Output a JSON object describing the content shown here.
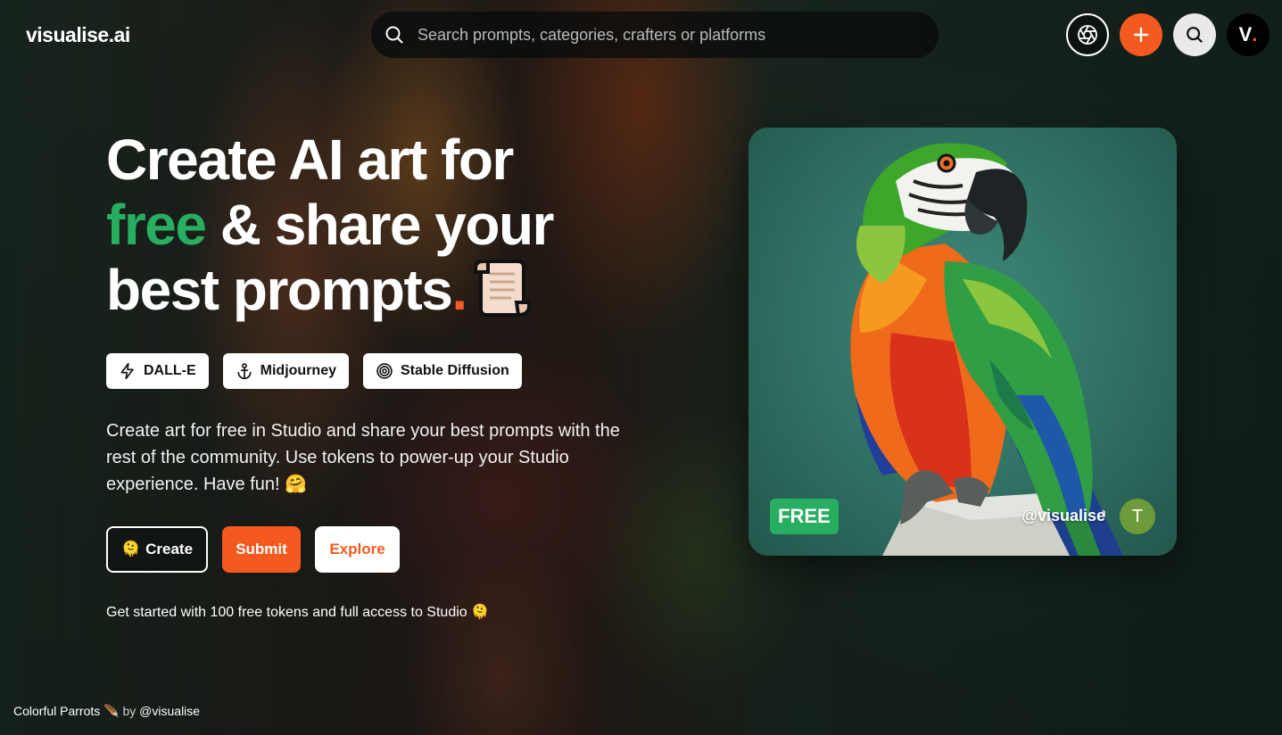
{
  "header": {
    "logo": "visualise",
    "logo_suffix": ".ai",
    "search_placeholder": "Search prompts, categories, crafters or platforms",
    "icons": [
      "aperture-icon",
      "plus-icon",
      "search-icon"
    ],
    "avatar_letter": "V",
    "avatar_dot": "."
  },
  "hero": {
    "line1": "Create AI art for",
    "line2_green": "free",
    "line2_rest": " & share your",
    "line3": "best prompts",
    "line3_dot": ".",
    "platforms": [
      {
        "label": "DALL-E",
        "icon": "lightning-icon"
      },
      {
        "label": "Midjourney",
        "icon": "anchor-icon"
      },
      {
        "label": "Stable Diffusion",
        "icon": "target-icon"
      }
    ],
    "description": "Create art for free in Studio and share your best prompts with the rest of the community. Use tokens to power-up your Studio experience. Have fun! 🤗",
    "buttons": {
      "create": "Create",
      "create_emoji": "🫠",
      "submit": "Submit",
      "explore": "Explore"
    },
    "note": "Get started with 100 free tokens and full access to Studio 🫠"
  },
  "card": {
    "badge": "FREE",
    "user": "@visualise",
    "avatar_letter": "T"
  },
  "footer": {
    "credit_title": "Colorful Parrots",
    "credit_emoji": "🪶",
    "credit_by": "by",
    "credit_user": "@visualise"
  },
  "colors": {
    "accent_orange": "#f45a1f",
    "accent_green": "#27ae60"
  }
}
